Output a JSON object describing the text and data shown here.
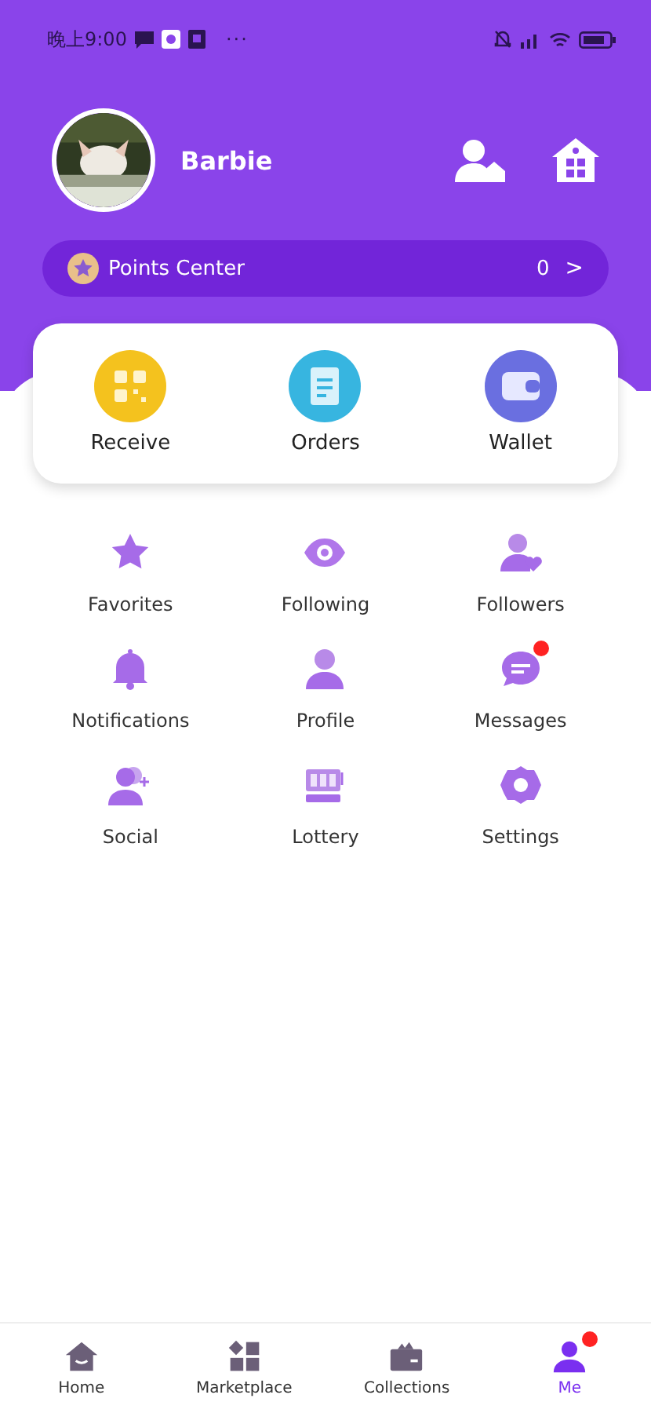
{
  "status_bar": {
    "time": "晚上9:00",
    "more": "···"
  },
  "profile": {
    "name": "Barbie"
  },
  "points": {
    "label": "Points Center",
    "value": "0",
    "chevron": ">"
  },
  "quick_actions": [
    {
      "label": "Receive",
      "kind": "qr"
    },
    {
      "label": "Orders",
      "kind": "orders"
    },
    {
      "label": "Wallet",
      "kind": "wallet"
    }
  ],
  "menu": [
    {
      "label": "Favorites",
      "kind": "star",
      "badge": false
    },
    {
      "label": "Following",
      "kind": "eye",
      "badge": false
    },
    {
      "label": "Followers",
      "kind": "follower",
      "badge": false
    },
    {
      "label": "Notifications",
      "kind": "bell",
      "badge": false
    },
    {
      "label": "Profile",
      "kind": "person",
      "badge": false
    },
    {
      "label": "Messages",
      "kind": "chat",
      "badge": true
    },
    {
      "label": "Social",
      "kind": "social",
      "badge": false
    },
    {
      "label": "Lottery",
      "kind": "lottery",
      "badge": false
    },
    {
      "label": "Settings",
      "kind": "gear",
      "badge": false
    }
  ],
  "tabs": [
    {
      "label": "Home",
      "kind": "home",
      "selected": false,
      "badge": false
    },
    {
      "label": "Marketplace",
      "kind": "market",
      "selected": false,
      "badge": false
    },
    {
      "label": "Collections",
      "kind": "collections",
      "selected": false,
      "badge": false
    },
    {
      "label": "Me",
      "kind": "me",
      "selected": true,
      "badge": true
    }
  ]
}
